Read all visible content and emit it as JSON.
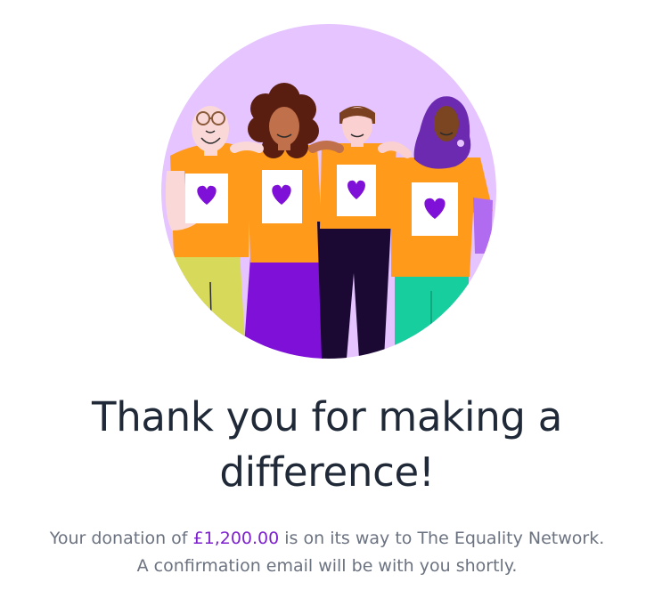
{
  "illustration": {
    "icon": "four-volunteers-heart-tshirts-illustration",
    "colors": {
      "circle_bg": "#e5c4ff",
      "shirt": "#ff9a1a",
      "heart": "#7e10d8",
      "skirt": "#7e10d8",
      "trousers_dark": "#1b0833",
      "trousers_green": "#17cf9e",
      "trousers_yellow": "#d6d95a",
      "hijab": "#6b2ab0"
    }
  },
  "thank_you": {
    "heading_line1": "Thank you for making a",
    "heading_line2": "difference!"
  },
  "confirmation": {
    "prefix": "Your donation of ",
    "amount": "£1,200.00",
    "suffix": " is on its way to The Equality Network.",
    "line2": "A confirmation email will be with you shortly.",
    "accent_color": "#7e22ce"
  }
}
